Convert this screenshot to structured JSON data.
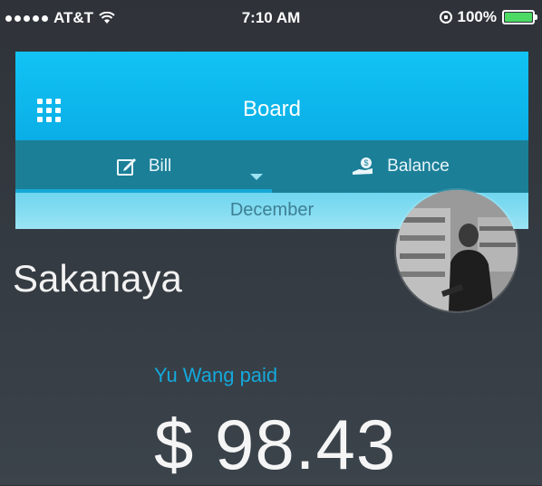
{
  "status_bar": {
    "carrier": "AT&T",
    "time": "7:10 AM",
    "battery_percent": "100%",
    "battery_level": 1.0,
    "battery_color": "#4cd964"
  },
  "header": {
    "title": "Board",
    "menu_icon": "grid-icon",
    "color": "#12c3f4"
  },
  "tabs": [
    {
      "label": "Bill",
      "icon": "edit-icon",
      "selected": true
    },
    {
      "label": "Balance",
      "icon": "money-hand-icon",
      "selected": false
    }
  ],
  "month": "December",
  "entry": {
    "merchant": "Sakanaya",
    "payer_text": "Yu Wang paid",
    "amount": "$ 98.43",
    "avatar": "user-avatar-photo"
  }
}
